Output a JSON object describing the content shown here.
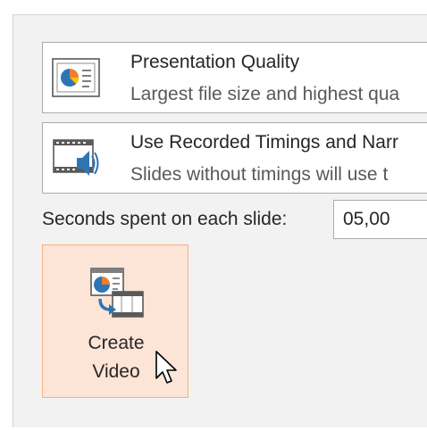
{
  "quality": {
    "title": "Presentation Quality",
    "description": "Largest file size and highest qua",
    "icon": "presentation-quality-icon"
  },
  "timings": {
    "title": "Use Recorded Timings and Narr",
    "description": "Slides without timings will use t",
    "icon": "recorded-timings-icon"
  },
  "seconds": {
    "label": "Seconds spent on each slide:",
    "value": "05,00"
  },
  "create_video": {
    "line1": "Create",
    "line2": "Video",
    "icon": "create-video-icon",
    "background": "#fce4d6",
    "border": "#f4b183"
  }
}
